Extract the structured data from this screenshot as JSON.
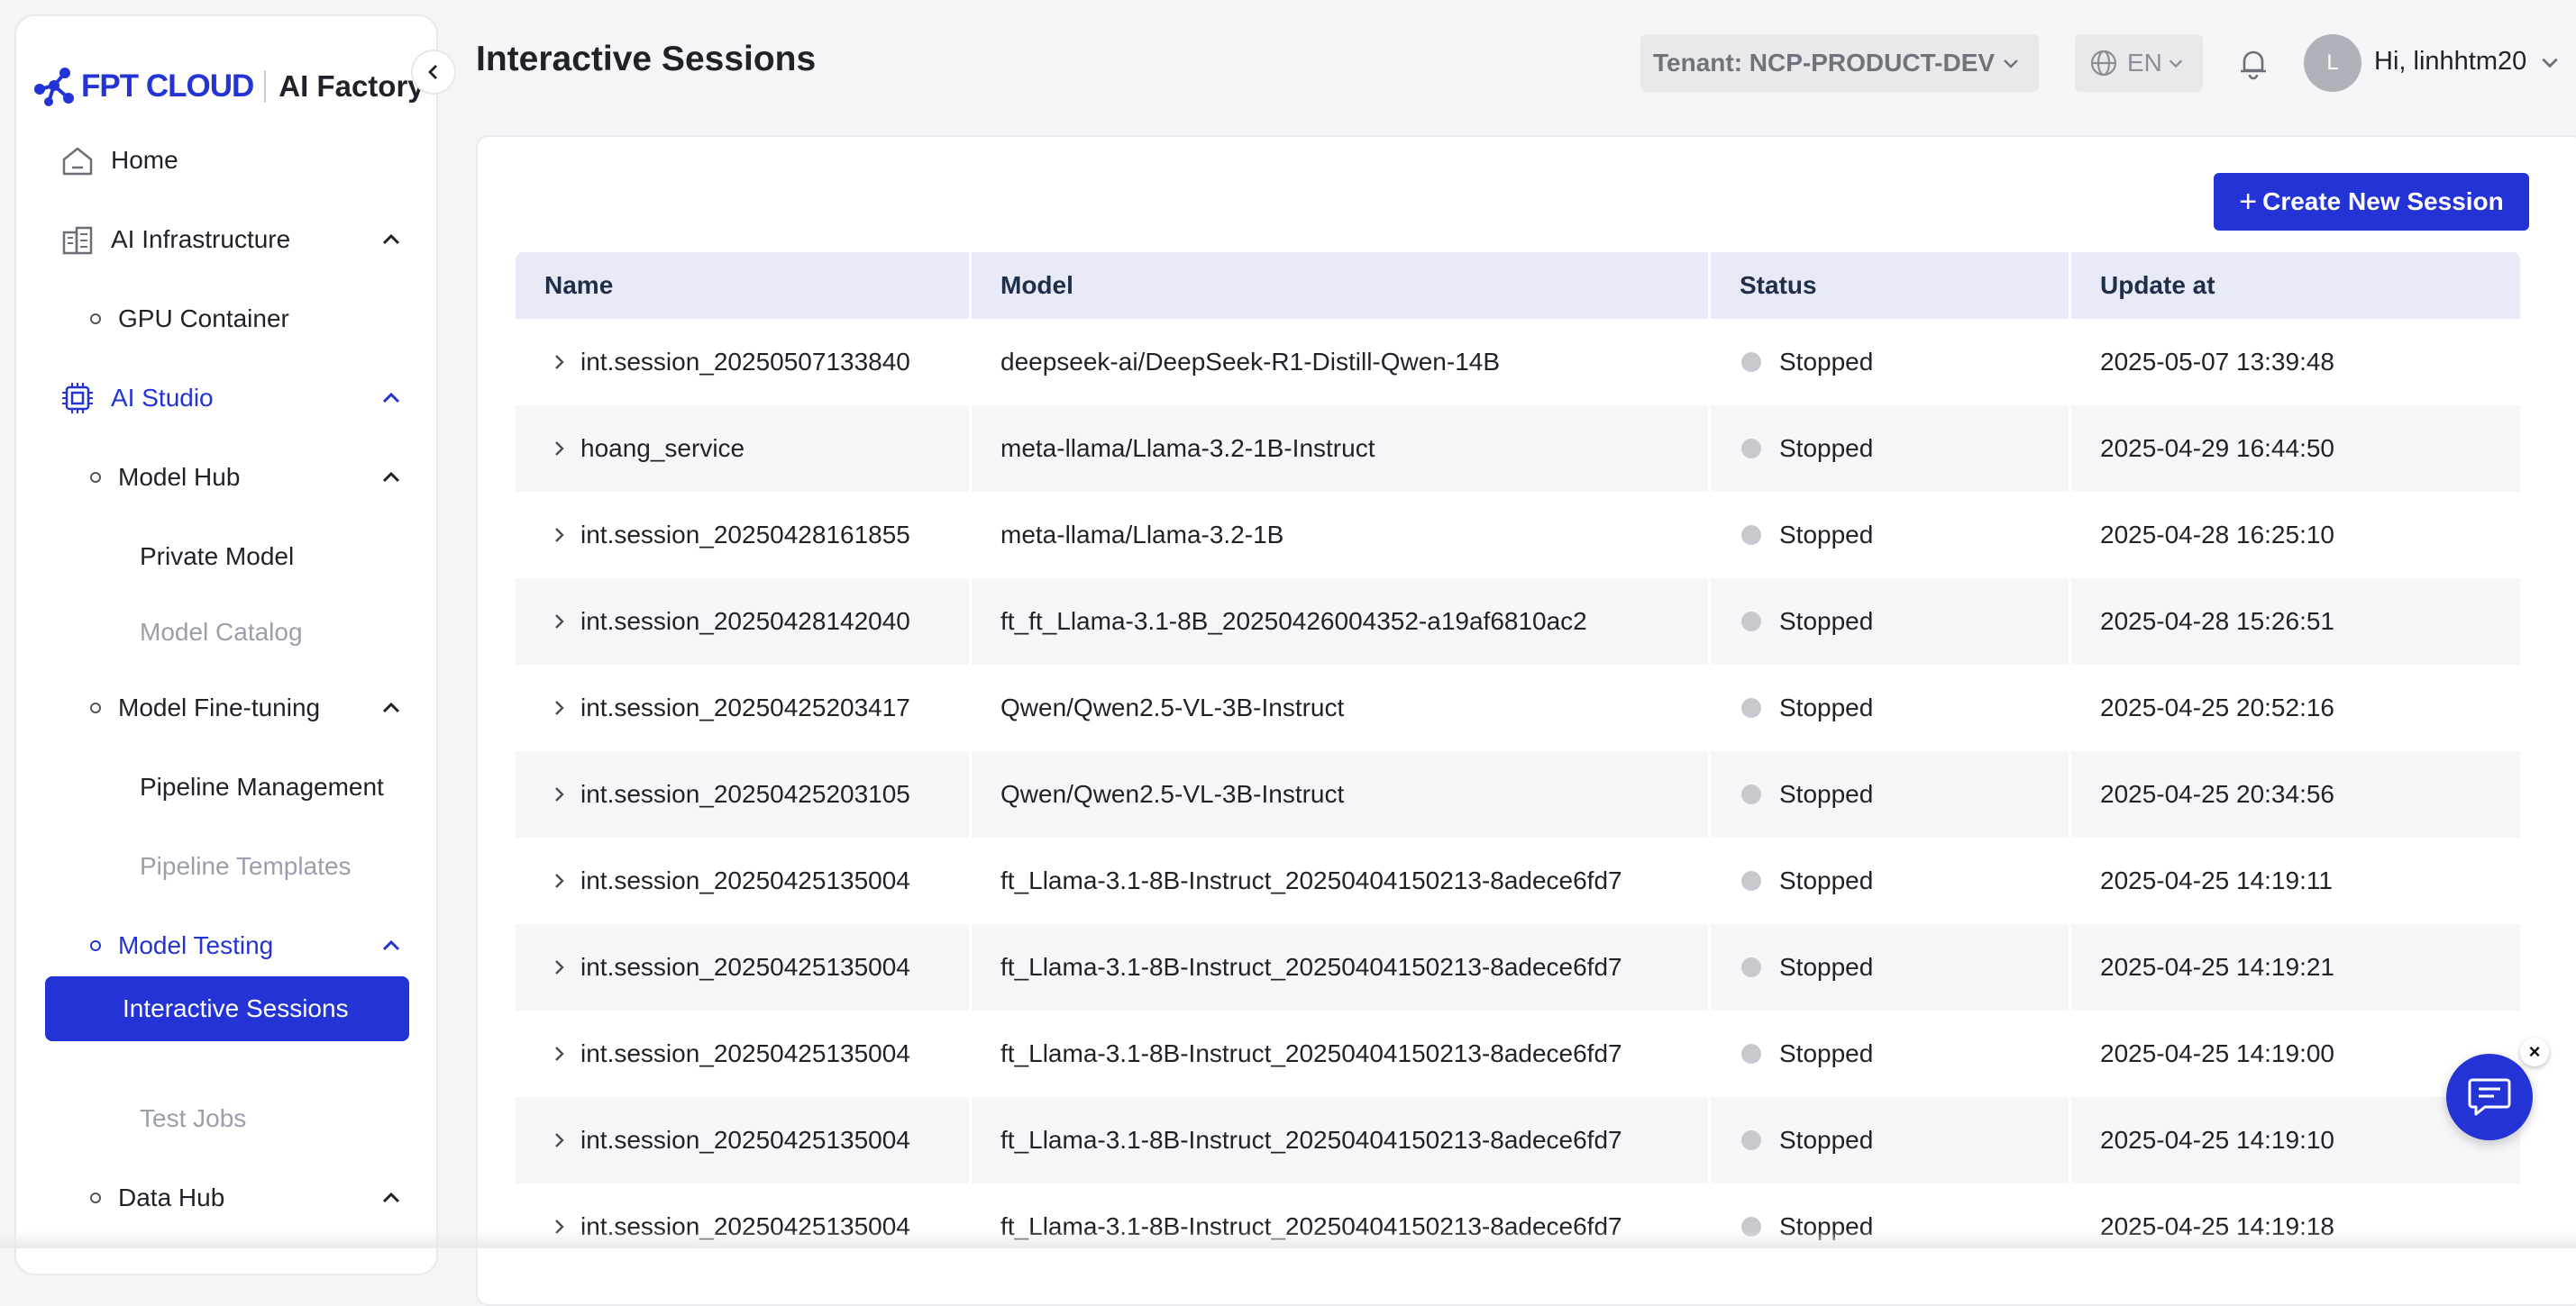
{
  "brand": {
    "logo_text": "FPT CLOUD",
    "product": "AI Factory",
    "accent": "#2433d6"
  },
  "header": {
    "title": "Interactive Sessions",
    "tenant": "Tenant: NCP-PRODUCT-DEV",
    "language": "EN",
    "avatar_initial": "L",
    "greeting": "Hi, linhhtm20"
  },
  "sidebar": {
    "home": "Home",
    "ai_infrastructure": "AI Infrastructure",
    "gpu_container": "GPU Container",
    "ai_studio": "AI Studio",
    "model_hub": "Model Hub",
    "private_model": "Private Model",
    "model_catalog": "Model Catalog",
    "model_finetuning": "Model Fine-tuning",
    "pipeline_management": "Pipeline Management",
    "pipeline_templates": "Pipeline Templates",
    "model_testing": "Model Testing",
    "interactive_sessions": "Interactive Sessions",
    "test_jobs": "Test Jobs",
    "data_hub": "Data Hub"
  },
  "toolbar": {
    "create_label": "Create New Session",
    "plus": "+"
  },
  "table": {
    "columns": [
      "Name",
      "Model",
      "Status",
      "Update at"
    ],
    "rows": [
      {
        "name": "int.session_20250507133840",
        "model": "deepseek-ai/DeepSeek-R1-Distill-Qwen-14B",
        "status": "Stopped",
        "updated": "2025-05-07 13:39:48"
      },
      {
        "name": "hoang_service",
        "model": "meta-llama/Llama-3.2-1B-Instruct",
        "status": "Stopped",
        "updated": "2025-04-29 16:44:50"
      },
      {
        "name": "int.session_20250428161855",
        "model": "meta-llama/Llama-3.2-1B",
        "status": "Stopped",
        "updated": "2025-04-28 16:25:10"
      },
      {
        "name": "int.session_20250428142040",
        "model": "ft_ft_Llama-3.1-8B_20250426004352-a19af6810ac2",
        "status": "Stopped",
        "updated": "2025-04-28 15:26:51"
      },
      {
        "name": "int.session_20250425203417",
        "model": "Qwen/Qwen2.5-VL-3B-Instruct",
        "status": "Stopped",
        "updated": "2025-04-25 20:52:16"
      },
      {
        "name": "int.session_20250425203105",
        "model": "Qwen/Qwen2.5-VL-3B-Instruct",
        "status": "Stopped",
        "updated": "2025-04-25 20:34:56"
      },
      {
        "name": "int.session_20250425135004",
        "model": "ft_Llama-3.1-8B-Instruct_20250404150213-8adece6fd7",
        "status": "Stopped",
        "updated": "2025-04-25 14:19:11"
      },
      {
        "name": "int.session_20250425135004",
        "model": "ft_Llama-3.1-8B-Instruct_20250404150213-8adece6fd7",
        "status": "Stopped",
        "updated": "2025-04-25 14:19:21"
      },
      {
        "name": "int.session_20250425135004",
        "model": "ft_Llama-3.1-8B-Instruct_20250404150213-8adece6fd7",
        "status": "Stopped",
        "updated": "2025-04-25 14:19:00"
      },
      {
        "name": "int.session_20250425135004",
        "model": "ft_Llama-3.1-8B-Instruct_20250404150213-8adece6fd7",
        "status": "Stopped",
        "updated": "2025-04-25 14:19:10"
      },
      {
        "name": "int.session_20250425135004",
        "model": "ft_Llama-3.1-8B-Instruct_20250404150213-8adece6fd7",
        "status": "Stopped",
        "updated": "2025-04-25 14:19:18"
      }
    ]
  },
  "chat_widget": {
    "close": "×"
  }
}
